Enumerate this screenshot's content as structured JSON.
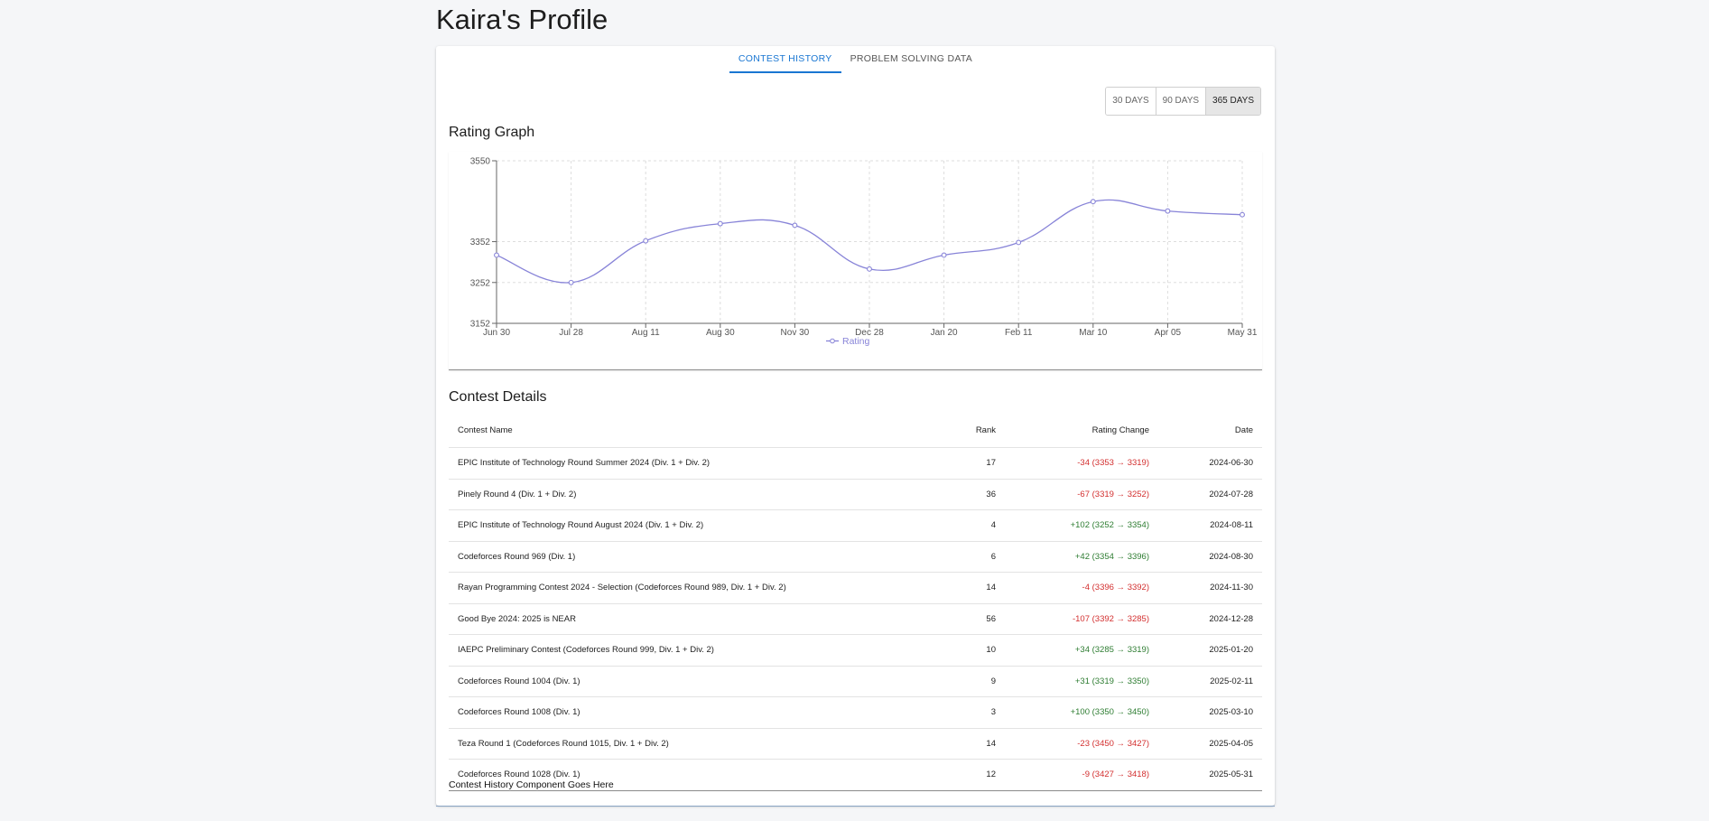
{
  "page": {
    "title": "Kaira's Profile"
  },
  "tabs": [
    {
      "label": "CONTEST HISTORY",
      "active": true
    },
    {
      "label": "PROBLEM SOLVING DATA",
      "active": false
    }
  ],
  "range_buttons": [
    {
      "label": "30 DAYS",
      "active": false
    },
    {
      "label": "90 DAYS",
      "active": false
    },
    {
      "label": "365 DAYS",
      "active": true
    }
  ],
  "rating_graph": {
    "heading": "Rating Graph"
  },
  "chart_data": {
    "type": "line",
    "title": "",
    "xlabel": "",
    "ylabel": "",
    "categories": [
      "Jun 30",
      "Jul 28",
      "Aug 11",
      "Aug 30",
      "Nov 30",
      "Dec 28",
      "Jan 20",
      "Feb 11",
      "Mar 10",
      "Apr 05",
      "May 31"
    ],
    "series": [
      {
        "name": "Rating",
        "values": [
          3319,
          3252,
          3354,
          3396,
          3392,
          3285,
          3319,
          3350,
          3450,
          3427,
          3418
        ]
      }
    ],
    "yticks": [
      3152,
      3252,
      3352,
      3550
    ],
    "ylim": [
      3152,
      3550
    ],
    "grid": true,
    "legend": "bottom-center",
    "color": "#8884d8"
  },
  "contest_details": {
    "heading": "Contest Details",
    "columns": {
      "name": "Contest Name",
      "rank": "Rank",
      "change": "Rating Change",
      "date": "Date"
    },
    "rows": [
      {
        "name": "EPIC Institute of Technology Round Summer 2024 (Div. 1 + Div. 2)",
        "rank": "17",
        "change": "-34 (3353 → 3319)",
        "sign": "neg",
        "date": "2024-06-30"
      },
      {
        "name": "Pinely Round 4 (Div. 1 + Div. 2)",
        "rank": "36",
        "change": "-67 (3319 → 3252)",
        "sign": "neg",
        "date": "2024-07-28"
      },
      {
        "name": "EPIC Institute of Technology Round August 2024 (Div. 1 + Div. 2)",
        "rank": "4",
        "change": "+102 (3252 → 3354)",
        "sign": "pos",
        "date": "2024-08-11"
      },
      {
        "name": "Codeforces Round 969 (Div. 1)",
        "rank": "6",
        "change": "+42 (3354 → 3396)",
        "sign": "pos",
        "date": "2024-08-30"
      },
      {
        "name": "Rayan Programming Contest 2024 - Selection (Codeforces Round 989, Div. 1 + Div. 2)",
        "rank": "14",
        "change": "-4 (3396 → 3392)",
        "sign": "neg",
        "date": "2024-11-30"
      },
      {
        "name": "Good Bye 2024: 2025 is NEAR",
        "rank": "56",
        "change": "-107 (3392 → 3285)",
        "sign": "neg",
        "date": "2024-12-28"
      },
      {
        "name": "IAEPC Preliminary Contest (Codeforces Round 999, Div. 1 + Div. 2)",
        "rank": "10",
        "change": "+34 (3285 → 3319)",
        "sign": "pos",
        "date": "2025-01-20"
      },
      {
        "name": "Codeforces Round 1004 (Div. 1)",
        "rank": "9",
        "change": "+31 (3319 → 3350)",
        "sign": "pos",
        "date": "2025-02-11"
      },
      {
        "name": "Codeforces Round 1008 (Div. 1)",
        "rank": "3",
        "change": "+100 (3350 → 3450)",
        "sign": "pos",
        "date": "2025-03-10"
      },
      {
        "name": "Teza Round 1 (Codeforces Round 1015, Div. 1 + Div. 2)",
        "rank": "14",
        "change": "-23 (3450 → 3427)",
        "sign": "neg",
        "date": "2025-04-05"
      },
      {
        "name": "Codeforces Round 1028 (Div. 1)",
        "rank": "12",
        "change": "-9 (3427 → 3418)",
        "sign": "neg",
        "date": "2025-05-31"
      }
    ]
  },
  "footer_note": "Contest History Component Goes Here"
}
